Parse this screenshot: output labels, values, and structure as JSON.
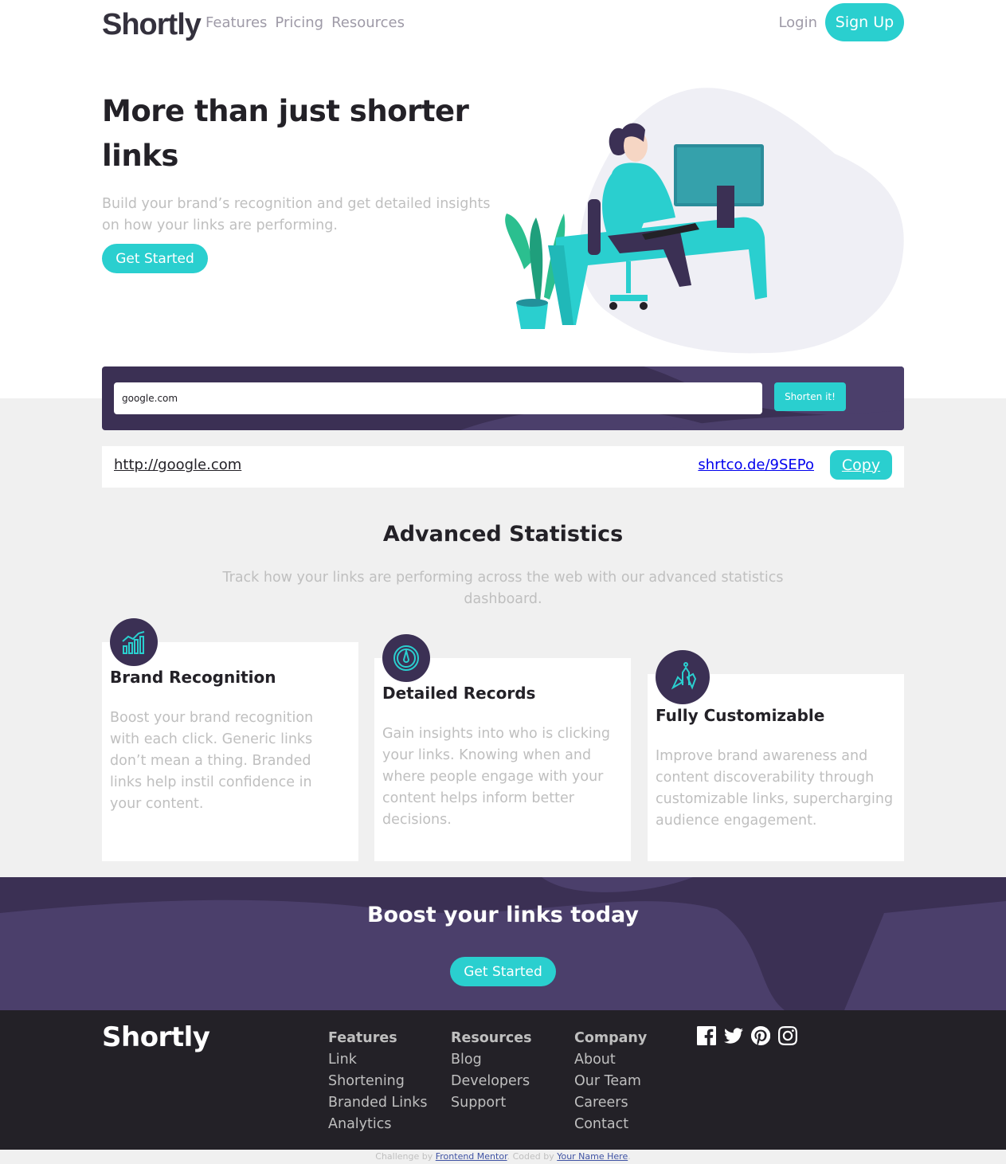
{
  "header": {
    "logo": "Shortly",
    "nav": [
      "Features",
      "Pricing",
      "Resources"
    ],
    "login": "Login",
    "signup": "Sign Up"
  },
  "hero": {
    "title": "More than just shorter links",
    "subtitle": "Build your brand’s recognition and get detailed insights on how your links are performing.",
    "cta": "Get Started"
  },
  "shortener": {
    "input_value": "google.com",
    "button": "Shorten it!",
    "result": {
      "original": "http://google.com",
      "short": "shrtco.de/9SEPo",
      "copy": "Copy"
    }
  },
  "stats": {
    "title": "Advanced Statistics",
    "subtitle": "Track how your links are performing across the web with our advanced statistics dashboard.",
    "cards": [
      {
        "icon": "brand-recognition-chart-icon",
        "title": "Brand Recognition",
        "text": "Boost your brand recognition with each click. Generic links don’t mean a thing. Branded links help instil confidence in your content."
      },
      {
        "icon": "detailed-records-gauge-icon",
        "title": "Detailed Records",
        "text": "Gain insights into who is clicking your links. Knowing when and where people engage with your content helps inform better decisions."
      },
      {
        "icon": "fully-customizable-pens-icon",
        "title": "Fully Customizable",
        "text": "Improve brand awareness and content discoverability through customizable links, supercharging audience engagement."
      }
    ]
  },
  "boost": {
    "title": "Boost your links today",
    "cta": "Get Started"
  },
  "footer": {
    "logo": "Shortly",
    "columns": [
      {
        "heading": "Features",
        "links": [
          "Link",
          "Shortening",
          "Branded Links",
          "Analytics"
        ]
      },
      {
        "heading": "Resources",
        "links": [
          "Blog",
          "Developers",
          "Support"
        ]
      },
      {
        "heading": "Company",
        "links": [
          "About",
          "Our Team",
          "Careers",
          "Contact"
        ]
      }
    ],
    "socials": [
      "facebook-icon",
      "twitter-icon",
      "pinterest-icon",
      "instagram-icon"
    ]
  },
  "attribution": {
    "prefix": "Challenge by",
    "mentor": "Frontend Mentor",
    "middle": ". Coded by",
    "author": "Your Name Here",
    "suffix": "."
  },
  "colors": {
    "cyan": "#2acfcf",
    "dark_violet": "#3b3054",
    "very_dark": "#232127",
    "gray": "#bfbfbf",
    "light_gray_bg": "#f0f0f0"
  }
}
